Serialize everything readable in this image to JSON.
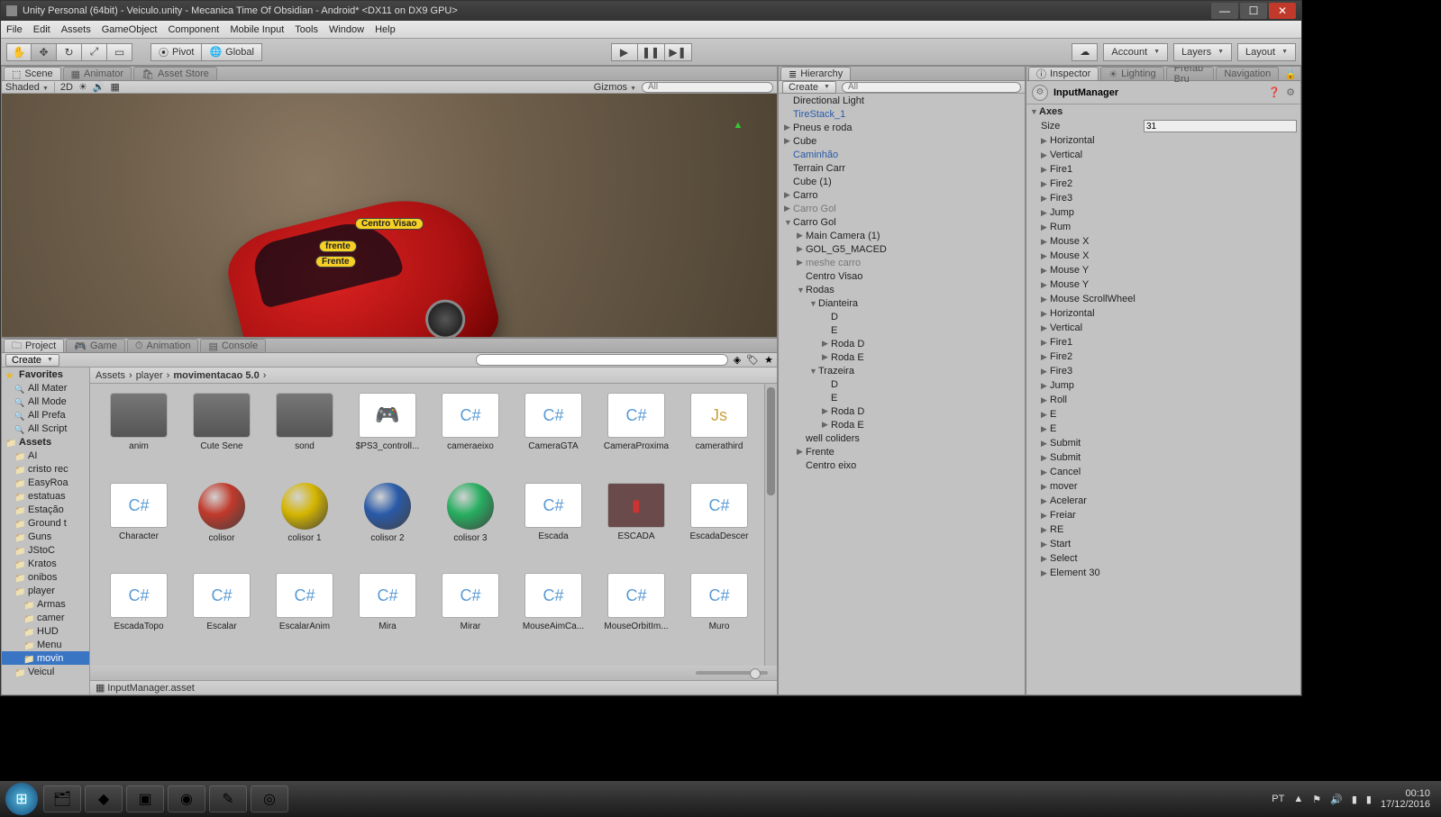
{
  "window": {
    "title": "Unity Personal (64bit) - Veiculo.unity - Mecanica Time Of Obsidian - Android* <DX11 on DX9 GPU>"
  },
  "menu": [
    "File",
    "Edit",
    "Assets",
    "GameObject",
    "Component",
    "Mobile Input",
    "Tools",
    "Window",
    "Help"
  ],
  "toolbar": {
    "pivot": "Pivot",
    "global": "Global",
    "account": "Account",
    "layers": "Layers",
    "layout": "Layout"
  },
  "scene": {
    "tabs": [
      "Scene",
      "Animator",
      "Asset Store"
    ],
    "shaded": "Shaded",
    "twoD": "2D",
    "gizmos": "Gizmos",
    "search_ph": "All",
    "labels": {
      "centro": "Centro Visao",
      "frente1": "frente",
      "frente2": "Frente"
    }
  },
  "hierarchy": {
    "title": "Hierarchy",
    "create": "Create",
    "search_ph": "All",
    "items": [
      {
        "t": "Directional Light",
        "ind": 0,
        "arr": ""
      },
      {
        "t": "TireStack_1",
        "ind": 0,
        "arr": "",
        "cls": "blue"
      },
      {
        "t": "Pneus e roda",
        "ind": 0,
        "arr": "▶"
      },
      {
        "t": "Cube",
        "ind": 0,
        "arr": "▶"
      },
      {
        "t": "Caminhão",
        "ind": 0,
        "arr": "",
        "cls": "blue"
      },
      {
        "t": "Terrain Carr",
        "ind": 0,
        "arr": ""
      },
      {
        "t": "Cube (1)",
        "ind": 0,
        "arr": ""
      },
      {
        "t": "Carro",
        "ind": 0,
        "arr": "▶"
      },
      {
        "t": "Carro  Gol",
        "ind": 0,
        "arr": "▶",
        "cls": "gray"
      },
      {
        "t": "Carro Gol",
        "ind": 0,
        "arr": "▼"
      },
      {
        "t": "Main Camera (1)",
        "ind": 1,
        "arr": "▶"
      },
      {
        "t": "GOL_G5_MACED",
        "ind": 1,
        "arr": "▶"
      },
      {
        "t": "meshe carro",
        "ind": 1,
        "arr": "▶",
        "cls": "gray"
      },
      {
        "t": "Centro Visao",
        "ind": 1,
        "arr": ""
      },
      {
        "t": "Rodas",
        "ind": 1,
        "arr": "▼"
      },
      {
        "t": "Dianteira",
        "ind": 2,
        "arr": "▼"
      },
      {
        "t": "D",
        "ind": 3,
        "arr": ""
      },
      {
        "t": "E",
        "ind": 3,
        "arr": ""
      },
      {
        "t": "Roda D",
        "ind": 3,
        "arr": "▶"
      },
      {
        "t": "Roda E",
        "ind": 3,
        "arr": "▶"
      },
      {
        "t": "Trazeira",
        "ind": 2,
        "arr": "▼"
      },
      {
        "t": "D",
        "ind": 3,
        "arr": ""
      },
      {
        "t": "E",
        "ind": 3,
        "arr": ""
      },
      {
        "t": "Roda D",
        "ind": 3,
        "arr": "▶"
      },
      {
        "t": "Roda E",
        "ind": 3,
        "arr": "▶"
      },
      {
        "t": "well coliders",
        "ind": 1,
        "arr": ""
      },
      {
        "t": "Frente",
        "ind": 1,
        "arr": "▶"
      },
      {
        "t": "Centro eixo",
        "ind": 1,
        "arr": ""
      }
    ]
  },
  "inspector": {
    "tabs": [
      "Inspector",
      "Lighting",
      "Prefab Bru",
      "Navigation"
    ],
    "object": "InputManager",
    "axes_label": "Axes",
    "size_label": "Size",
    "size_value": "31",
    "axes": [
      "Horizontal",
      "Vertical",
      "Fire1",
      "Fire2",
      "Fire3",
      "Jump",
      "Rum",
      "Mouse X",
      "Mouse X",
      "Mouse Y",
      "Mouse Y",
      "Mouse ScrollWheel",
      "Horizontal",
      "Vertical",
      "Fire1",
      "Fire2",
      "Fire3",
      "Jump",
      "Roll",
      "E",
      "E",
      "Submit",
      "Submit",
      "Cancel",
      "mover",
      "Acelerar",
      "Freiar",
      "RE",
      "Start",
      "Select",
      "Element 30"
    ]
  },
  "project": {
    "tabs": [
      "Project",
      "Game",
      "Animation",
      "Console"
    ],
    "create": "Create",
    "search_ph": "",
    "breadcrumb": [
      "Assets",
      "player",
      "movimentacao 5.0"
    ],
    "tree_fav_header": "Favorites",
    "tree_fav": [
      "All Mater",
      "All Mode",
      "All Prefa",
      "All Script"
    ],
    "tree_assets_header": "Assets",
    "tree_assets": [
      "AI",
      "cristo rec",
      "EasyRoa",
      "estatuas",
      "Estação",
      "Ground t",
      "Guns",
      "JStoC",
      "Kratos",
      "onibos"
    ],
    "tree_player": "player",
    "tree_player_children": [
      "Armas",
      "camer",
      "HUD",
      "Menu"
    ],
    "tree_sel": "movin",
    "tree_last": "Veicul",
    "assets": [
      {
        "n": "anim",
        "k": "folder"
      },
      {
        "n": "Cute Sene",
        "k": "folder"
      },
      {
        "n": "sond",
        "k": "folder"
      },
      {
        "n": "$PS3_controll...",
        "k": "img"
      },
      {
        "n": "cameraeixo",
        "k": "cs"
      },
      {
        "n": "CameraGTA",
        "k": "cs"
      },
      {
        "n": "CameraProxima",
        "k": "cs"
      },
      {
        "n": "camerathird",
        "k": "js"
      },
      {
        "n": "Character",
        "k": "cs"
      },
      {
        "n": "colisor",
        "k": "ball",
        "c": "#c0392b"
      },
      {
        "n": "colisor 1",
        "k": "ball",
        "c": "#d4b500"
      },
      {
        "n": "colisor 2",
        "k": "ball",
        "c": "#2a5aa8"
      },
      {
        "n": "colisor 3",
        "k": "ball",
        "c": "#27ae60"
      },
      {
        "n": "Escada",
        "k": "cs"
      },
      {
        "n": "ESCADA",
        "k": "prefab"
      },
      {
        "n": "EscadaDescer",
        "k": "cs"
      },
      {
        "n": "EscadaTopo",
        "k": "cs"
      },
      {
        "n": "Escalar",
        "k": "cs"
      },
      {
        "n": "EscalarAnim",
        "k": "cs"
      },
      {
        "n": "Mira",
        "k": "cs"
      },
      {
        "n": "Mirar",
        "k": "cs"
      },
      {
        "n": "MouseAimCa...",
        "k": "cs"
      },
      {
        "n": "MouseOrbitIm...",
        "k": "cs"
      },
      {
        "n": "Muro",
        "k": "cs"
      }
    ],
    "status": "InputManager.asset"
  },
  "taskbar": {
    "lang": "PT",
    "time": "00:10",
    "date": "17/12/2016"
  }
}
